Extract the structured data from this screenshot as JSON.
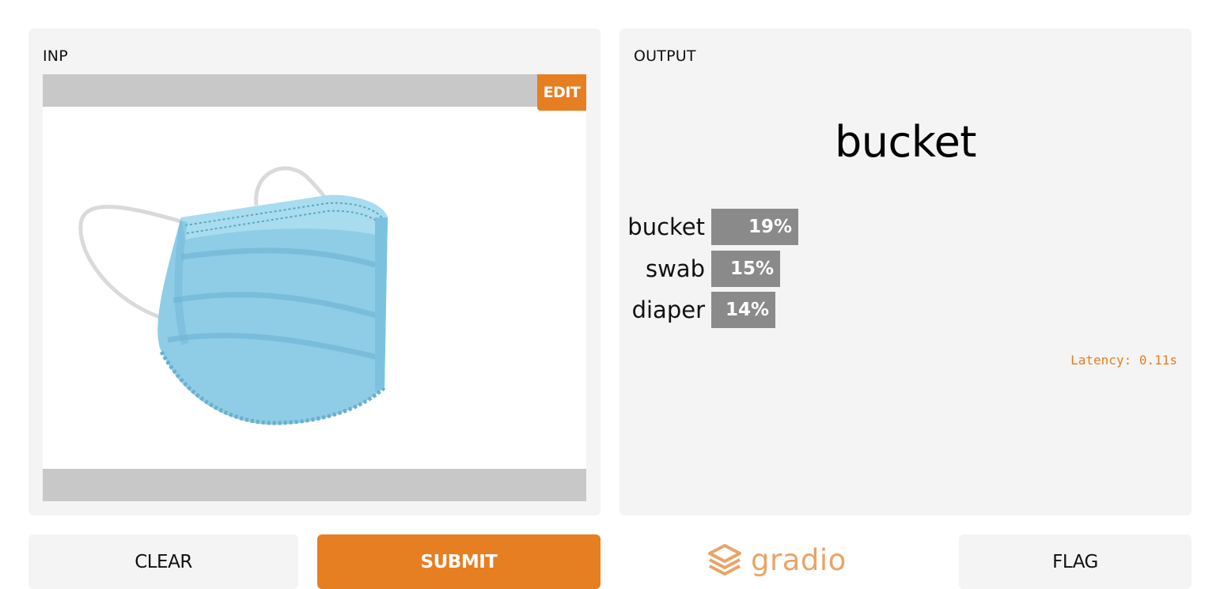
{
  "input": {
    "title": "INP",
    "edit_label": "EDIT",
    "image_icon": "surgical-mask-image"
  },
  "output": {
    "title": "OUTPUT",
    "top_label": "bucket",
    "confidences": [
      {
        "label": "bucket",
        "percent_text": "19%",
        "value": 0.19
      },
      {
        "label": "swab",
        "percent_text": "15%",
        "value": 0.15
      },
      {
        "label": "diaper",
        "percent_text": "14%",
        "value": 0.14
      }
    ],
    "latency": "Latency: 0.11s"
  },
  "buttons": {
    "clear": "CLEAR",
    "submit": "SUBMIT",
    "flag": "FLAG"
  },
  "logo": {
    "text": "gradio",
    "icon": "gradio-logo-icon"
  },
  "colors": {
    "accent": "#e67e22",
    "panel": "#f4f4f4",
    "bar": "#8a8a8a",
    "logo": "#e8a468"
  }
}
